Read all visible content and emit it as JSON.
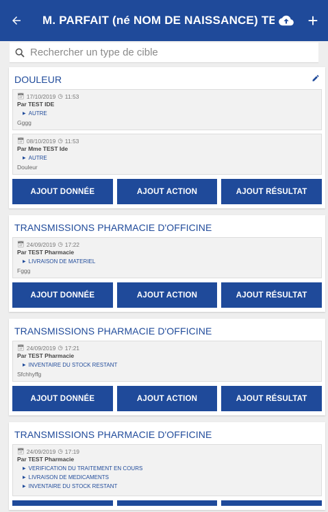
{
  "appbar": {
    "title": "M. PARFAIT (né NOM DE NAISSANCE) TE...",
    "back_icon": "arrow-left-icon",
    "upload_icon": "cloud-upload-icon",
    "add_icon": "plus-icon"
  },
  "search": {
    "placeholder": "Rechercher un type de cible"
  },
  "buttons": {
    "donnee": "AJOUT DONNÉE",
    "action": "AJOUT ACTION",
    "resultat": "AJOUT RÉSULTAT"
  },
  "cards": [
    {
      "title": "DOULEUR",
      "entries": [
        {
          "date": "17/10/2019",
          "time": "11:53",
          "author": "Par TEST IDE",
          "tags": [
            "AUTRE"
          ],
          "note": "Gggg"
        },
        {
          "date": "08/10/2019",
          "time": "11:53",
          "author": "Par Mme TEST Ide",
          "tags": [
            "AUTRE"
          ],
          "note": "Douleur"
        }
      ]
    },
    {
      "title": "TRANSMISSIONS PHARMACIE D'OFFICINE",
      "entries": [
        {
          "date": "24/09/2019",
          "time": "17:22",
          "author": "Par TEST Pharmacie",
          "tags": [
            "LIVRAISON DE MATERIEL"
          ],
          "note": "Fggg"
        }
      ]
    },
    {
      "title": "TRANSMISSIONS PHARMACIE D'OFFICINE",
      "entries": [
        {
          "date": "24/09/2019",
          "time": "17:21",
          "author": "Par TEST Pharmacie",
          "tags": [
            "INVENTAIRE DU STOCK RESTANT"
          ],
          "note": "Sfchhyffg"
        }
      ]
    },
    {
      "title": "TRANSMISSIONS PHARMACIE D'OFFICINE",
      "entries": [
        {
          "date": "24/09/2019",
          "time": "17:19",
          "author": "Par TEST Pharmacie",
          "tags": [
            "VERIFICATION DU TRAITEMENT EN COURS",
            "LIVRAISON DE MEDICAMENTS",
            "INVENTAIRE DU STOCK RESTANT"
          ],
          "note": ""
        }
      ]
    }
  ],
  "colors": {
    "primary": "#1f4a9a",
    "background": "#eeeeee",
    "entry_bg": "#f2f2f2"
  }
}
